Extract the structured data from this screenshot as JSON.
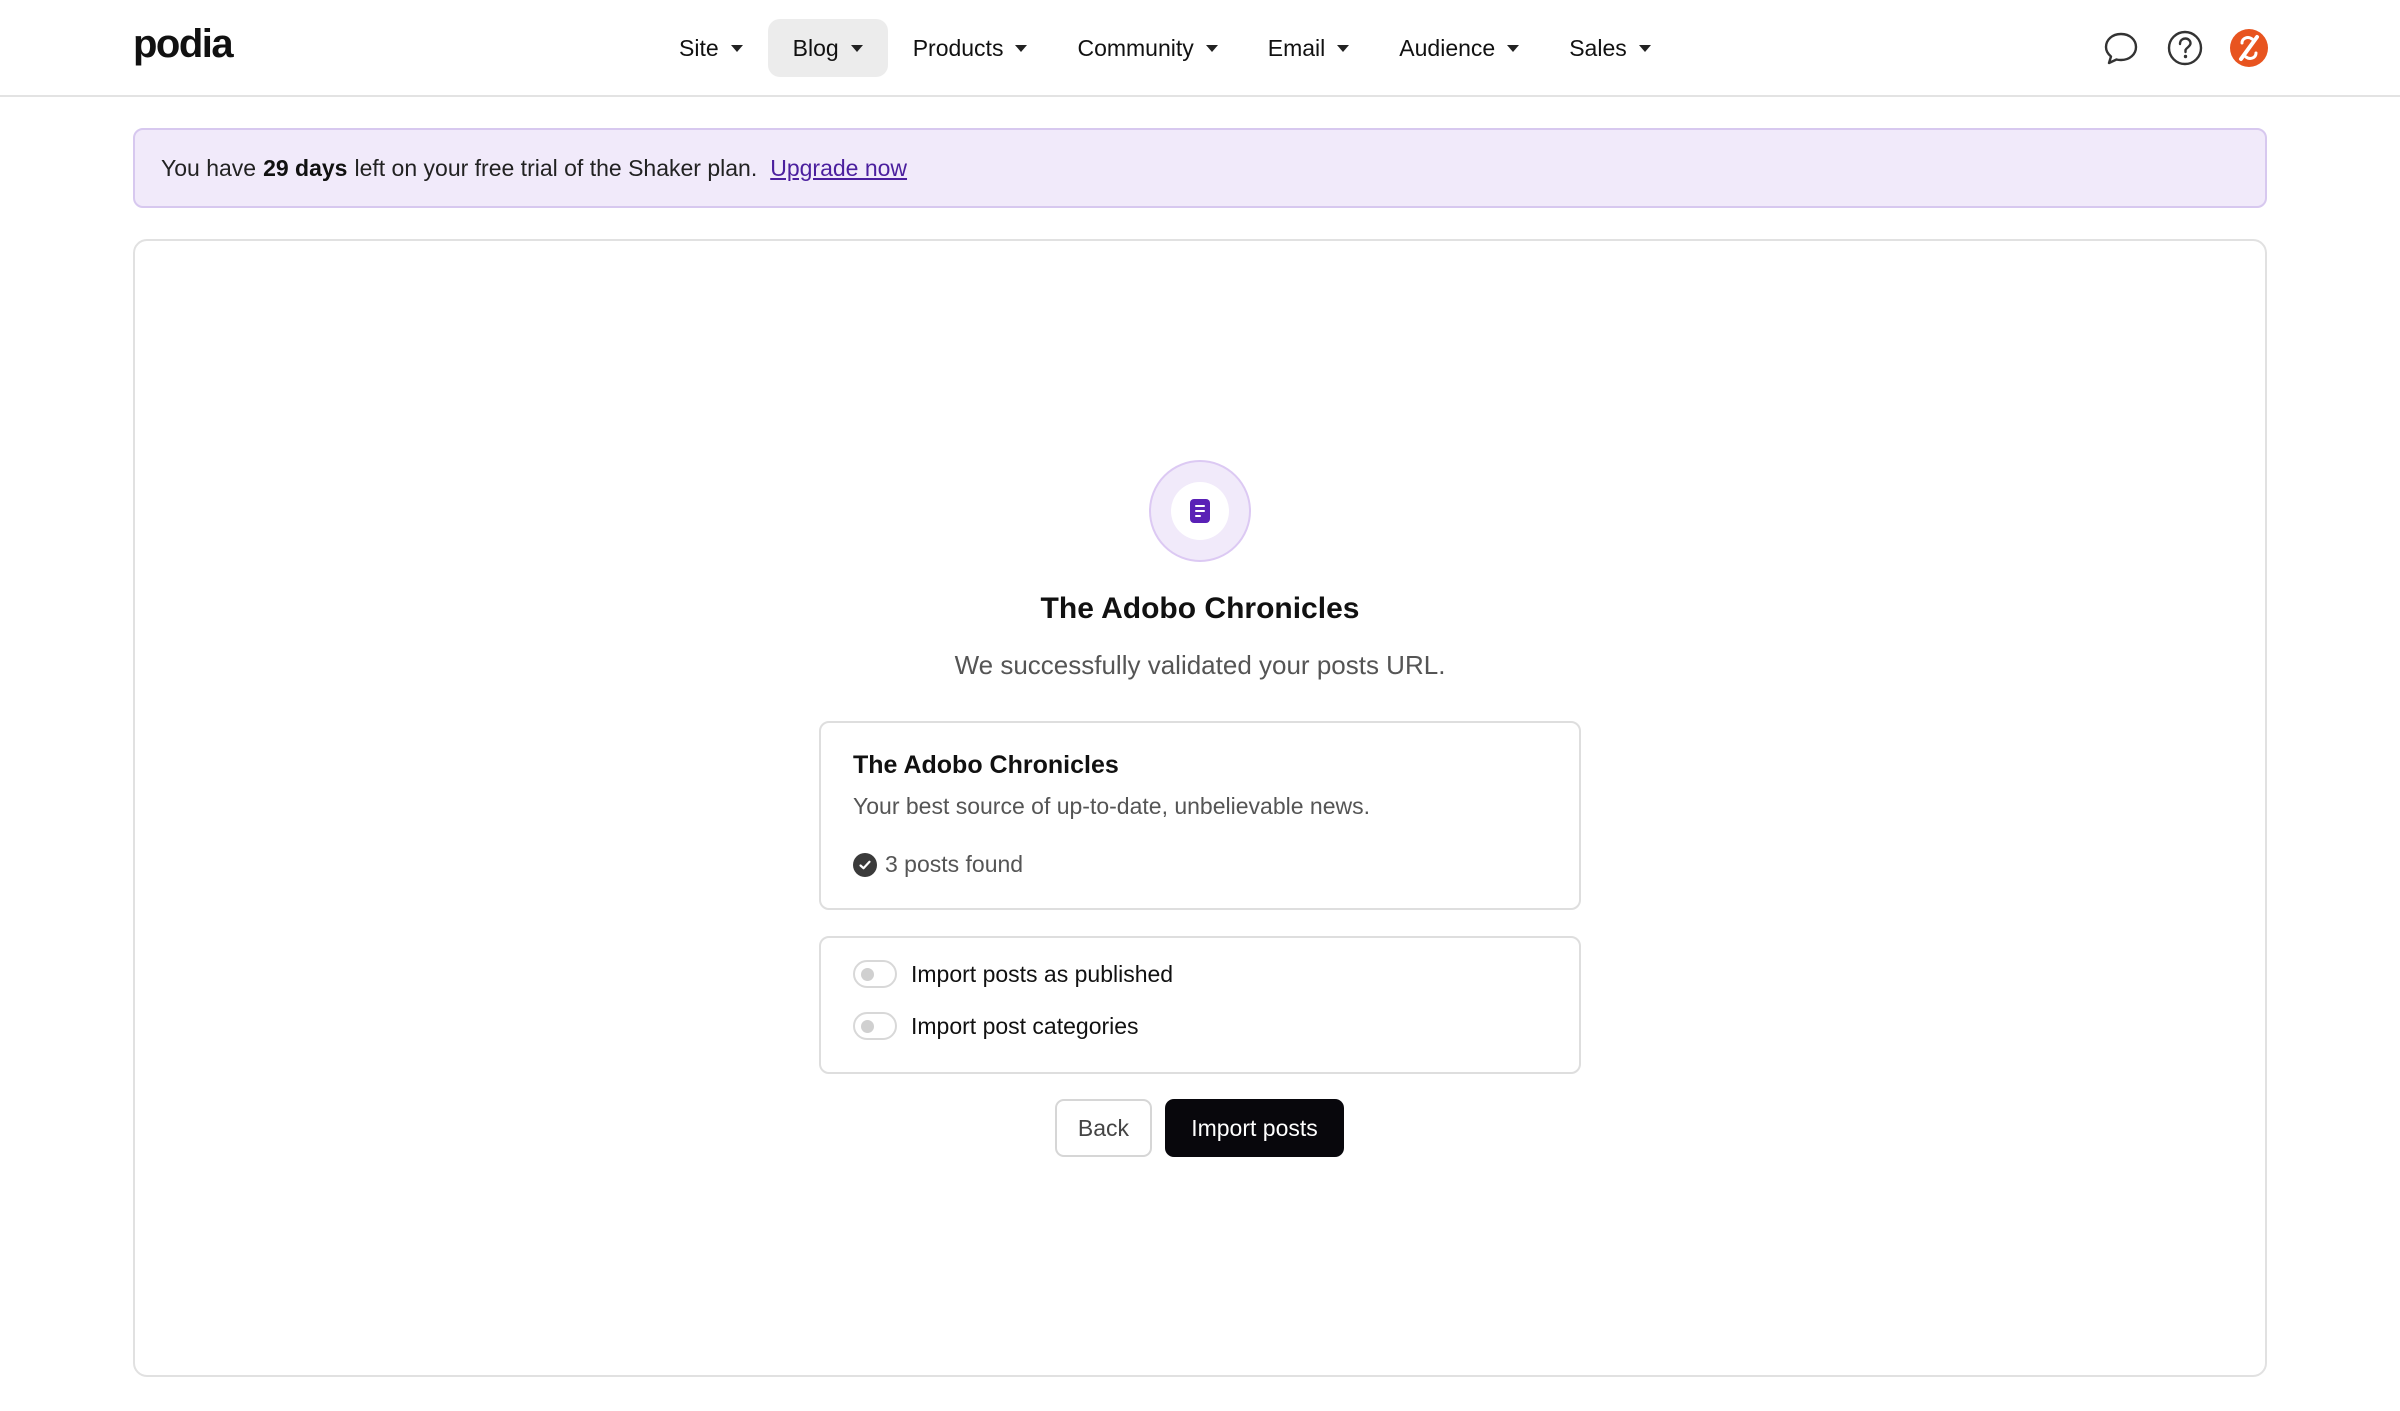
{
  "header": {
    "logo": "podia",
    "nav": [
      {
        "label": "Site"
      },
      {
        "label": "Blog",
        "active": true
      },
      {
        "label": "Products"
      },
      {
        "label": "Community"
      },
      {
        "label": "Email"
      },
      {
        "label": "Audience"
      },
      {
        "label": "Sales"
      }
    ],
    "icons": [
      "chat-bubble-icon",
      "help-circle-icon",
      "avatar"
    ]
  },
  "banner": {
    "prefix": "You have",
    "days": "29 days",
    "suffix": "left on your free trial of the Shaker plan.",
    "link": "Upgrade now"
  },
  "main": {
    "icon": "document-icon",
    "title": "The Adobo Chronicles",
    "subtitle": "We successfully validated your posts URL.",
    "blog_card": {
      "title": "The Adobo Chronicles",
      "description": "Your best source of up-to-date, unbelievable news.",
      "status": "3 posts found"
    },
    "options": [
      {
        "label": "Import posts as published",
        "checked": false
      },
      {
        "label": "Import post categories",
        "checked": false
      }
    ],
    "buttons": {
      "back": "Back",
      "import": "Import posts"
    }
  },
  "colors": {
    "accent": "#5a21b6",
    "banner_bg": "#f1eafa",
    "banner_border": "#d7c8ef",
    "primary_button": "#08070c",
    "avatar": "#e8541f"
  }
}
